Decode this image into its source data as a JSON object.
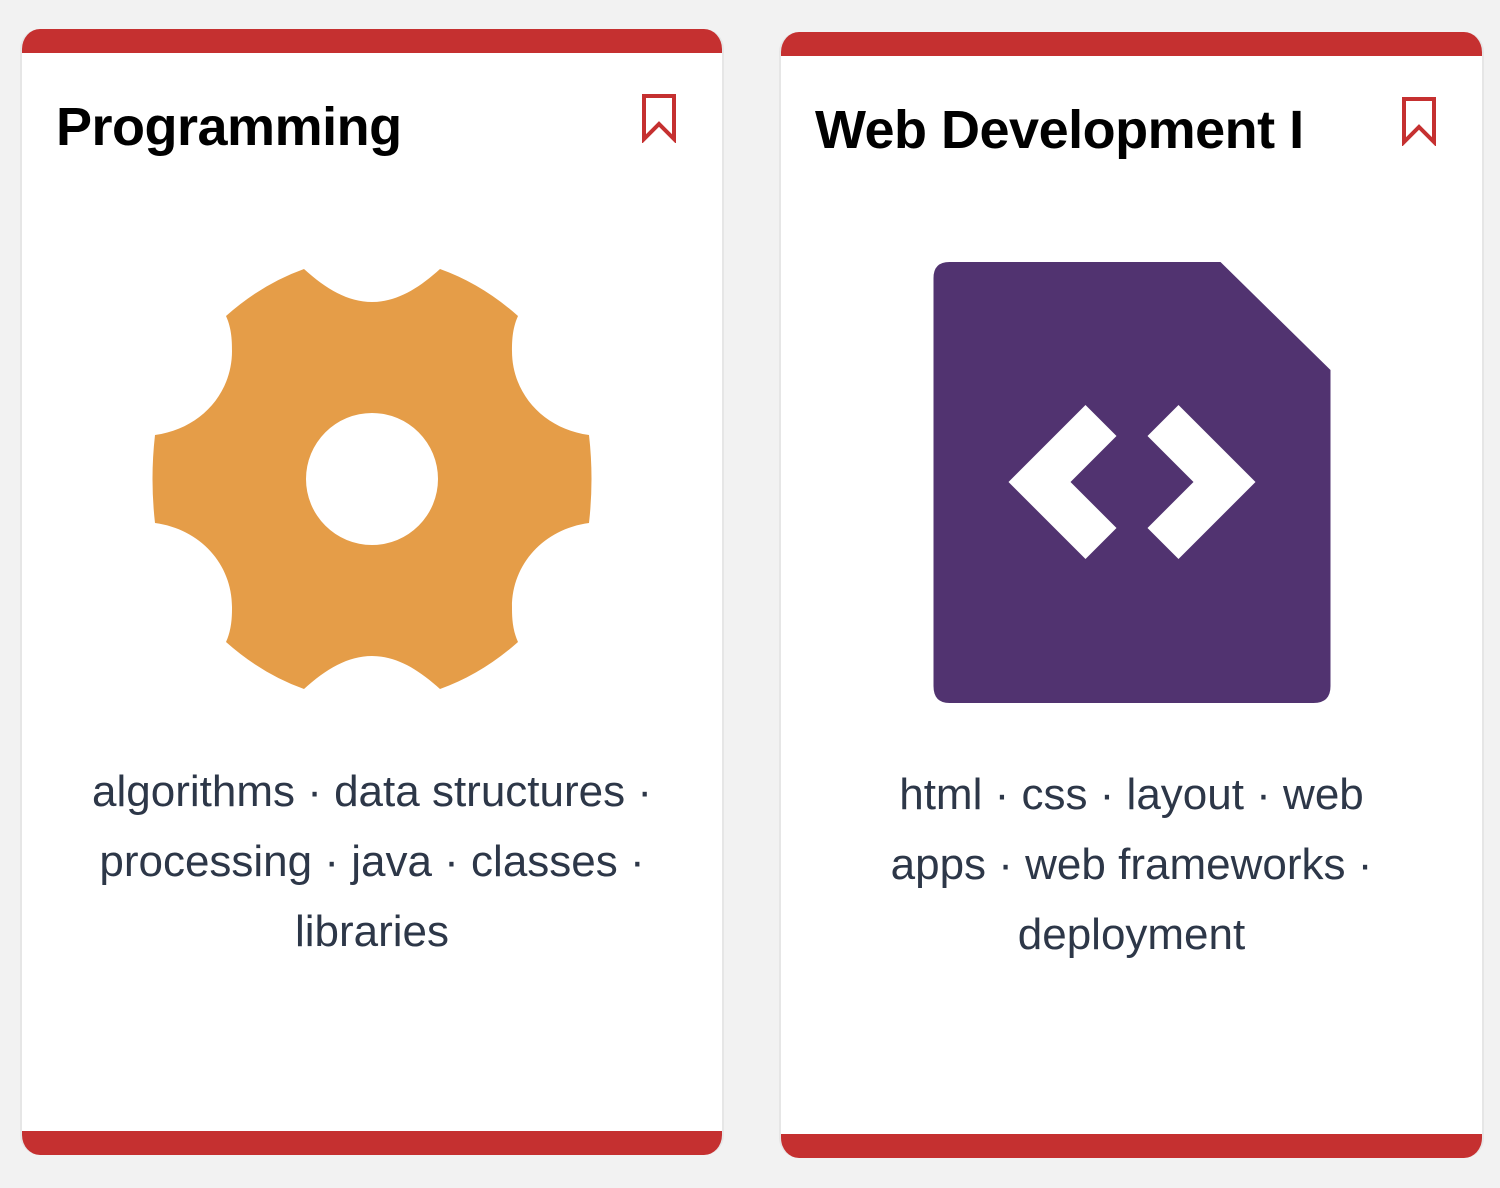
{
  "cards": [
    {
      "title": "Programming",
      "tags": "algorithms · data structures · processing · java · classes · libraries",
      "icon": "gear-icon",
      "icon_color": "#e59d48",
      "bookmark_icon": "bookmark-icon"
    },
    {
      "title": "Web Development I",
      "tags": "html · css · layout · web apps · web frameworks · deployment",
      "icon": "code-file-icon",
      "icon_color": "#513370",
      "bookmark_icon": "bookmark-icon"
    }
  ],
  "colors": {
    "accent": "#c53030",
    "background": "#f2f2f2",
    "card": "#ffffff",
    "title_text": "#000000",
    "tag_text": "#2d3748"
  }
}
